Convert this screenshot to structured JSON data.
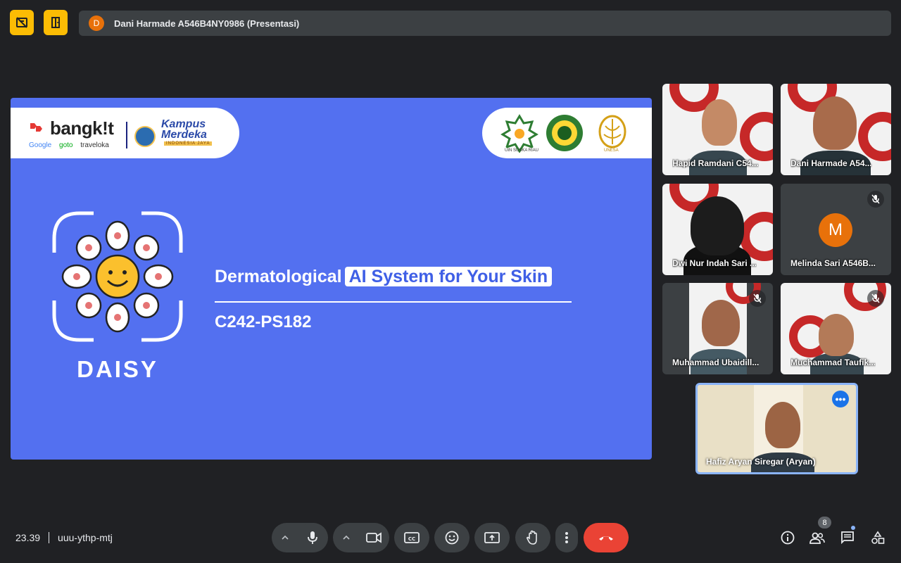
{
  "top_bar": {
    "presenter_initial": "D",
    "presenter_label": "Dani Harmade A546B4NY0986 (Presentasi)"
  },
  "slide": {
    "brand": "bangk!t",
    "partners": [
      "Google",
      "goto",
      "traveloka"
    ],
    "kampus_title_line1": "Kampus",
    "kampus_title_line2": "Merdeka",
    "kampus_sub": "INDONESIA JAYA",
    "uni_caption_1": "UIN SUSKA RIAU",
    "uni_caption_3": "UNESA",
    "headline_part1": "Dermatological",
    "headline_part2": "AI System for Your Skin",
    "team_code": "C242-PS182",
    "product_name": "DAISY"
  },
  "participants": [
    {
      "name": "Hapid Ramdani C54...",
      "muted": false
    },
    {
      "name": "Dani Harmade A54...",
      "muted": false
    },
    {
      "name": "Dwi Nur Indah Sari ...",
      "muted": false
    },
    {
      "name": "Melinda Sari A546B...",
      "muted": true,
      "initial": "M"
    },
    {
      "name": "Muhammad Ubaidill...",
      "muted": true
    },
    {
      "name": "Muchammad Taufik...",
      "muted": true
    }
  ],
  "self_view": {
    "name": "Hafiz Aryan Siregar (Aryan)",
    "more_icon": "more-horiz-icon"
  },
  "bottom_bar": {
    "time": "23.39",
    "meeting_code": "uuu-ythp-mtj",
    "people_count": "8"
  },
  "colors": {
    "slide_blue": "#5370f0",
    "presenter_yellow": "#fbbc04",
    "end_call_red": "#ea4335",
    "self_border": "#8ab4f8"
  }
}
